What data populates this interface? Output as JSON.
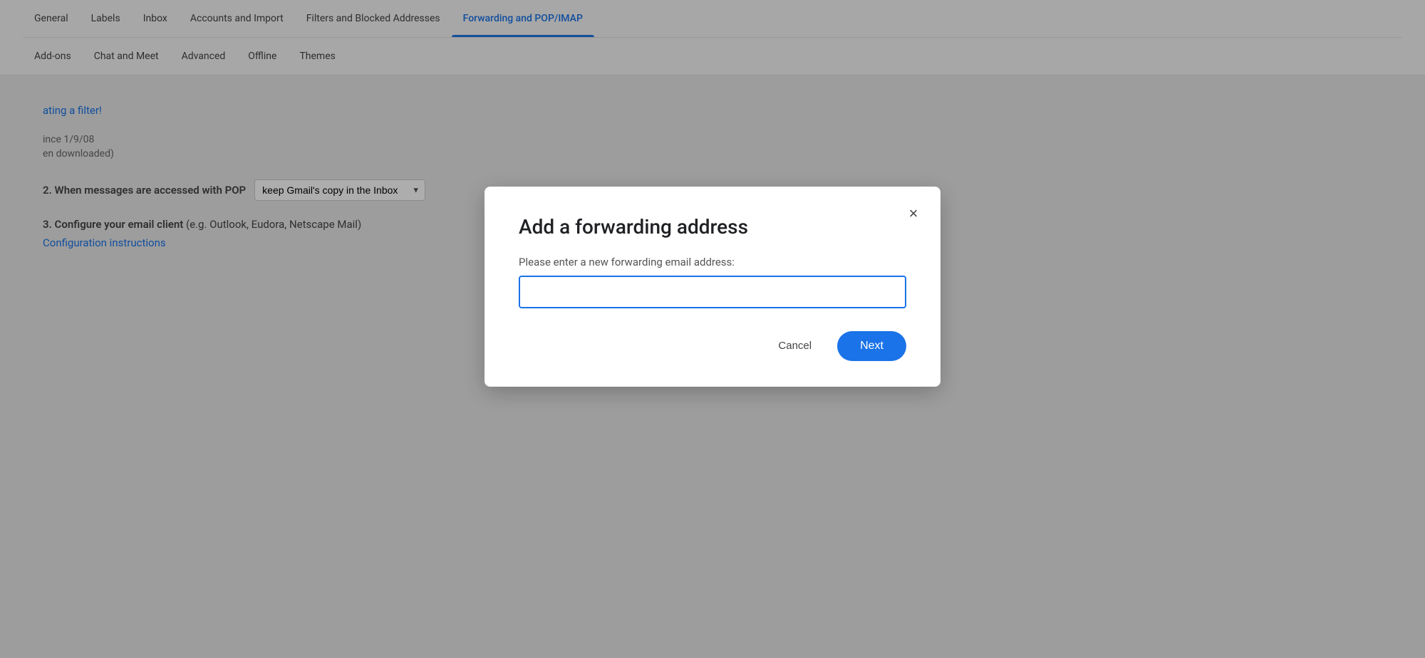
{
  "nav": {
    "row1": [
      {
        "label": "General",
        "active": false
      },
      {
        "label": "Labels",
        "active": false
      },
      {
        "label": "Inbox",
        "active": false
      },
      {
        "label": "Accounts and Import",
        "active": false
      },
      {
        "label": "Filters and Blocked Addresses",
        "active": false
      },
      {
        "label": "Forwarding and POP/IMAP",
        "active": true
      }
    ],
    "row2": [
      {
        "label": "Add-ons",
        "active": false
      },
      {
        "label": "Chat and Meet",
        "active": false
      },
      {
        "label": "Advanced",
        "active": false
      },
      {
        "label": "Offline",
        "active": false
      },
      {
        "label": "Themes",
        "active": false
      }
    ]
  },
  "background": {
    "filter_link": "ating a filter!",
    "pop_label": "2. When messages are accessed with POP",
    "pop_dropdown_value": "keep Gmail's copy in the Inbox",
    "configure_label": "3. Configure your email client",
    "configure_sub": "(e.g. Outlook, Eudora, Netscape Mail)",
    "config_instructions": "Configuration instructions",
    "since_text": "ince 1/9/08",
    "downloaded_text": "en downloaded)"
  },
  "modal": {
    "title": "Add a forwarding address",
    "label": "Please enter a new forwarding email address:",
    "input_value": "",
    "input_placeholder": "",
    "cancel_label": "Cancel",
    "next_label": "Next",
    "close_icon": "×"
  }
}
